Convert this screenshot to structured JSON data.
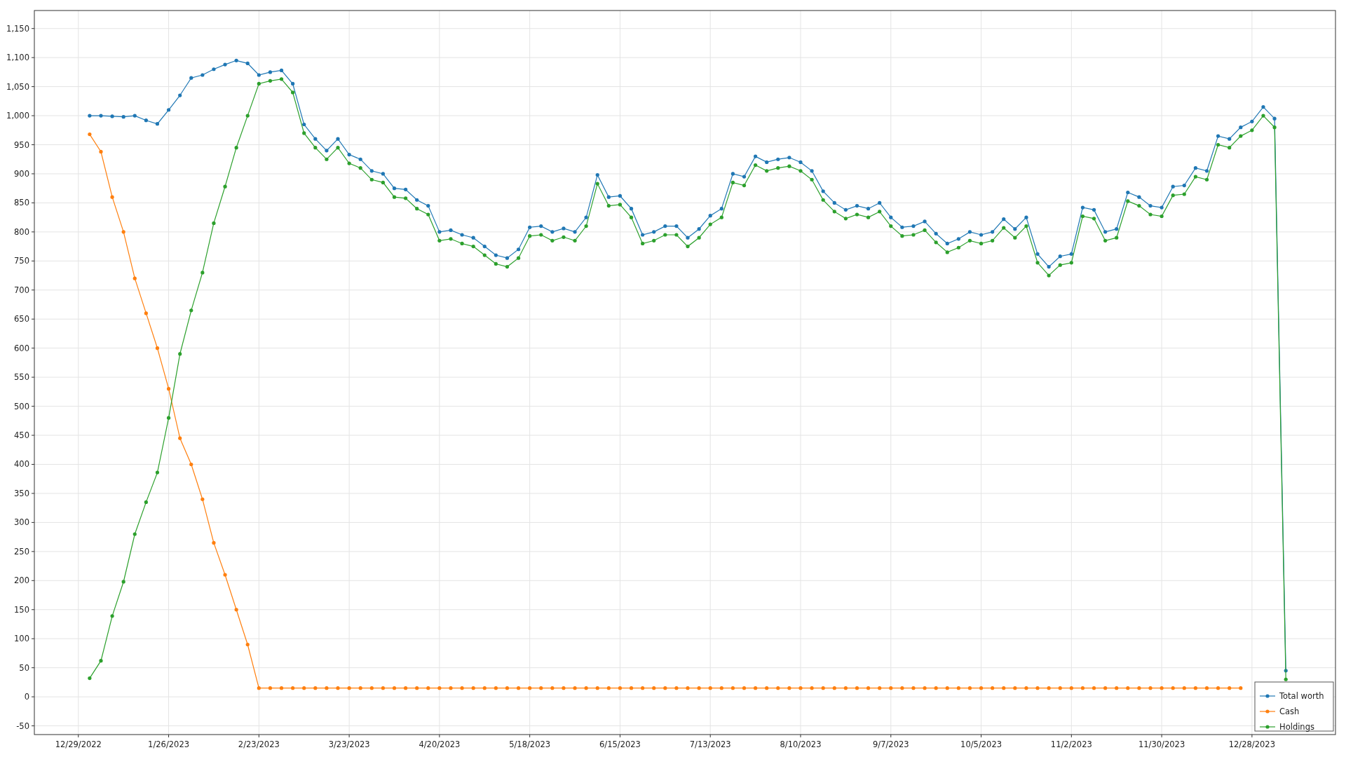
{
  "chart_data": {
    "type": "line",
    "grid": true,
    "legend": true,
    "categories": [
      "12/29/2022",
      null,
      null,
      null,
      null,
      null,
      null,
      null,
      "1/26/2023",
      null,
      null,
      null,
      null,
      null,
      null,
      null,
      "2/23/2023",
      null,
      null,
      null,
      null,
      null,
      null,
      null,
      "3/23/2023",
      null,
      null,
      null,
      null,
      null,
      null,
      null,
      "4/20/2023",
      null,
      null,
      null,
      null,
      null,
      null,
      null,
      "5/18/2023",
      null,
      null,
      null,
      null,
      null,
      null,
      null,
      "6/15/2023",
      null,
      null,
      null,
      null,
      null,
      null,
      null,
      "7/13/2023",
      null,
      null,
      null,
      null,
      null,
      null,
      null,
      "8/10/2023",
      null,
      null,
      null,
      null,
      null,
      null,
      null,
      "9/7/2023",
      null,
      null,
      null,
      null,
      null,
      null,
      null,
      "10/5/2023",
      null,
      null,
      null,
      null,
      null,
      null,
      null,
      "11/2/2023",
      null,
      null,
      null,
      null,
      null,
      null,
      null,
      "11/30/2023",
      null,
      null,
      null,
      null,
      null,
      null,
      null,
      "12/28/2023",
      null,
      null,
      null
    ],
    "series": [
      {
        "name": "Total worth",
        "color": "#1f77b4",
        "values": [
          null,
          1000,
          1000,
          999,
          998,
          1000,
          992,
          986,
          1010,
          1035,
          1065,
          1070,
          1080,
          1088,
          1095,
          1090,
          1070,
          1075,
          1078,
          1055,
          985,
          960,
          940,
          960,
          933,
          925,
          905,
          900,
          875,
          873,
          855,
          845,
          800,
          803,
          795,
          790,
          775,
          760,
          755,
          770,
          808,
          810,
          800,
          806,
          800,
          825,
          898,
          860,
          862,
          840,
          795,
          800,
          810,
          810,
          790,
          805,
          828,
          840,
          900,
          895,
          930,
          920,
          925,
          928,
          920,
          905,
          870,
          850,
          838,
          845,
          840,
          850,
          825,
          808,
          810,
          818,
          797,
          780,
          788,
          800,
          795,
          800,
          822,
          805,
          825,
          762,
          740,
          758,
          762,
          842,
          838,
          800,
          805,
          868,
          860,
          845,
          842,
          878,
          880,
          910,
          905,
          965,
          960,
          980,
          990,
          1015,
          995,
          45
        ]
      },
      {
        "name": "Cash",
        "color": "#ff7f0e",
        "values": [
          null,
          968,
          938,
          860,
          800,
          720,
          660,
          600,
          530,
          445,
          400,
          340,
          265,
          210,
          150,
          90,
          15,
          15,
          15,
          15,
          15,
          15,
          15,
          15,
          15,
          15,
          15,
          15,
          15,
          15,
          15,
          15,
          15,
          15,
          15,
          15,
          15,
          15,
          15,
          15,
          15,
          15,
          15,
          15,
          15,
          15,
          15,
          15,
          15,
          15,
          15,
          15,
          15,
          15,
          15,
          15,
          15,
          15,
          15,
          15,
          15,
          15,
          15,
          15,
          15,
          15,
          15,
          15,
          15,
          15,
          15,
          15,
          15,
          15,
          15,
          15,
          15,
          15,
          15,
          15,
          15,
          15,
          15,
          15,
          15,
          15,
          15,
          15,
          15,
          15,
          15,
          15,
          15,
          15,
          15,
          15,
          15,
          15,
          15,
          15,
          15,
          15,
          15,
          15,
          null,
          null,
          null,
          null
        ]
      },
      {
        "name": "Holdings",
        "color": "#2ca02c",
        "values": [
          null,
          32,
          62,
          139,
          198,
          280,
          335,
          386,
          480,
          590,
          665,
          730,
          815,
          878,
          945,
          1000,
          1055,
          1060,
          1063,
          1040,
          970,
          945,
          925,
          945,
          918,
          910,
          890,
          885,
          860,
          858,
          840,
          830,
          785,
          788,
          780,
          775,
          760,
          745,
          740,
          755,
          793,
          795,
          785,
          791,
          785,
          810,
          883,
          845,
          847,
          825,
          780,
          785,
          795,
          795,
          775,
          790,
          813,
          825,
          885,
          880,
          915,
          905,
          910,
          913,
          905,
          890,
          855,
          835,
          823,
          830,
          825,
          835,
          810,
          793,
          795,
          803,
          782,
          765,
          773,
          785,
          780,
          785,
          807,
          790,
          810,
          747,
          725,
          743,
          747,
          827,
          823,
          785,
          790,
          853,
          845,
          830,
          827,
          863,
          865,
          895,
          890,
          950,
          945,
          965,
          975,
          1000,
          980,
          30
        ]
      }
    ],
    "ylim": [
      -65,
      1181
    ],
    "yticks": [
      {
        "value": -50,
        "label": "-50"
      },
      {
        "value": 0,
        "label": "0"
      },
      {
        "value": 50,
        "label": "50"
      },
      {
        "value": 100,
        "label": "100"
      },
      {
        "value": 150,
        "label": "150"
      },
      {
        "value": 200,
        "label": "200"
      },
      {
        "value": 250,
        "label": "250"
      },
      {
        "value": 300,
        "label": "300"
      },
      {
        "value": 350,
        "label": "350"
      },
      {
        "value": 400,
        "label": "400"
      },
      {
        "value": 450,
        "label": "450"
      },
      {
        "value": 500,
        "label": "500"
      },
      {
        "value": 550,
        "label": "550"
      },
      {
        "value": 600,
        "label": "600"
      },
      {
        "value": 650,
        "label": "650"
      },
      {
        "value": 700,
        "label": "700"
      },
      {
        "value": 750,
        "label": "750"
      },
      {
        "value": 800,
        "label": "800"
      },
      {
        "value": 850,
        "label": "850"
      },
      {
        "value": 900,
        "label": "900"
      },
      {
        "value": 950,
        "label": "950"
      },
      {
        "value": 1000,
        "label": "1,000"
      },
      {
        "value": 1050,
        "label": "1,050"
      },
      {
        "value": 1100,
        "label": "1,100"
      },
      {
        "value": 1150,
        "label": "1,150"
      }
    ]
  }
}
